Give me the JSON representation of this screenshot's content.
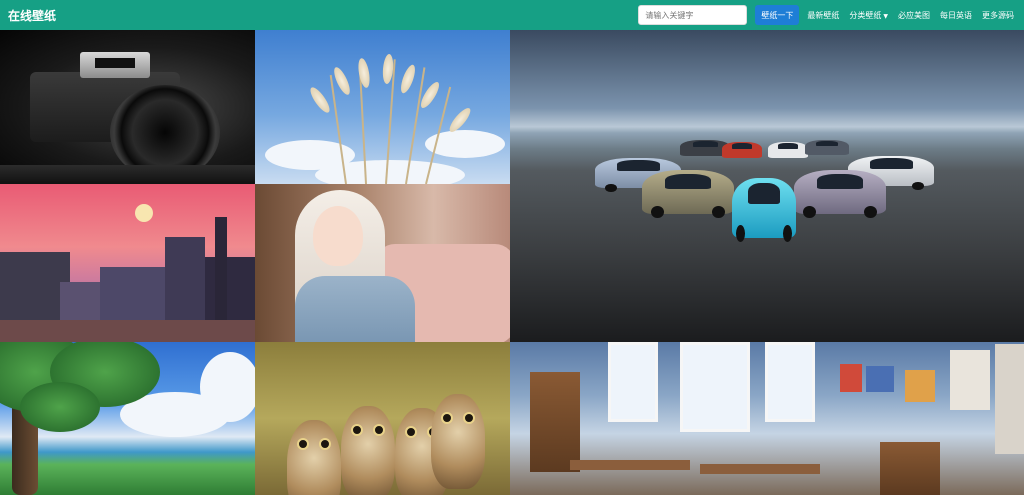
{
  "site": {
    "brand": "在线壁纸"
  },
  "search": {
    "placeholder": "请输入关键字",
    "button_label": "壁纸一下"
  },
  "nav": {
    "links": [
      "最新壁纸",
      "分类壁纸",
      "必应美图",
      "每日英语",
      "更多源码"
    ]
  },
  "colors": {
    "navbar": "#16a085",
    "search_button": "#1e7ed6",
    "text": "#ffffff"
  },
  "gallery": {
    "images": [
      {
        "subject": "camera"
      },
      {
        "subject": "reeds"
      },
      {
        "subject": "cars"
      },
      {
        "subject": "city"
      },
      {
        "subject": "girl"
      },
      {
        "subject": "tree-coast"
      },
      {
        "subject": "owls"
      },
      {
        "subject": "room"
      }
    ]
  }
}
